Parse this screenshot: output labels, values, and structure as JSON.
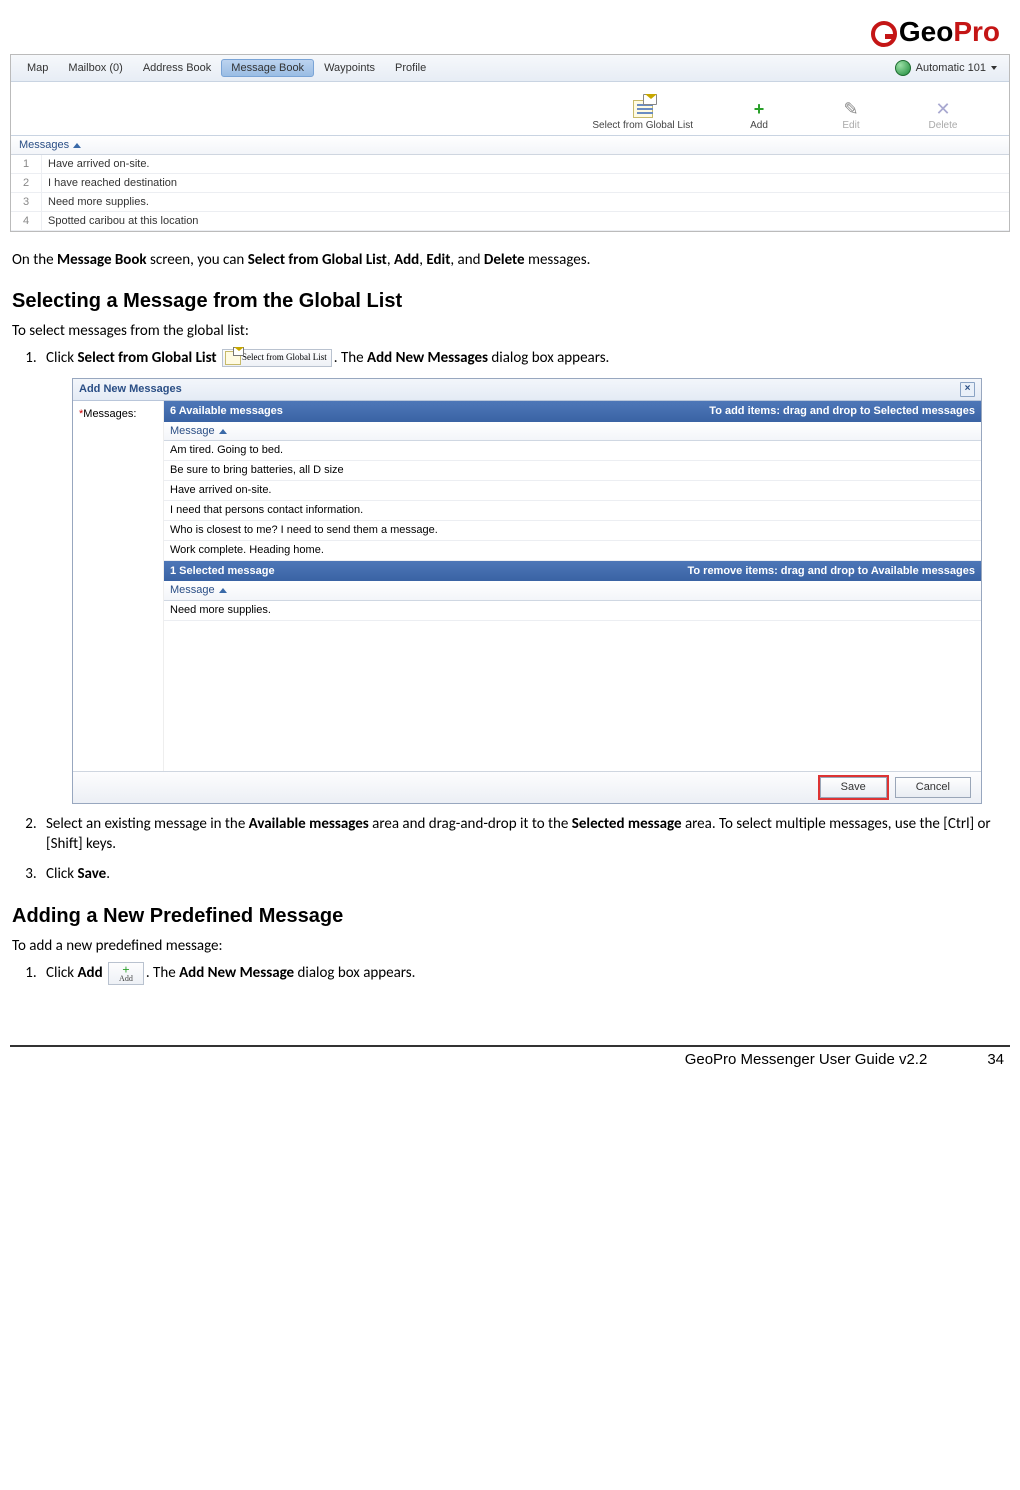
{
  "logo": {
    "part1": "Geo",
    "part2": "Pro"
  },
  "app": {
    "menu": [
      "Map",
      "Mailbox (0)",
      "Address Book",
      "Message Book",
      "Waypoints",
      "Profile"
    ],
    "menu_active_index": 3,
    "mode_label": "Automatic 101",
    "toolbar": {
      "select": "Select from Global List",
      "add": "Add",
      "edit": "Edit",
      "delete": "Delete"
    },
    "column_header": "Messages",
    "rows": [
      "Have arrived on-site.",
      "I have reached destination",
      "Need more supplies.",
      "Spotted caribou at this location"
    ]
  },
  "intro": {
    "pre": "On the ",
    "b1": "Message Book",
    "mid1": " screen, you can ",
    "b2": "Select from Global List",
    "c1": ", ",
    "b3": "Add",
    "c2": ", ",
    "b4": "Edit",
    "c3": ", and ",
    "b5": "Delete",
    "post": " messages."
  },
  "sectionA": {
    "heading": "Selecting a Message from the Global List",
    "lead": "To select messages from the global list:",
    "step1_a": "Click ",
    "step1_b": "Select from Global List",
    "step1_btn": "Select from Global List",
    "step1_c": ". The ",
    "step1_d": "Add New Messages",
    "step1_e": " dialog box appears.",
    "step2_a": "Select an existing message in the ",
    "step2_b": "Available messages",
    "step2_c": " area and drag-and-drop it to the ",
    "step2_d": "Selected message",
    "step2_e": " area. To select multiple messages, use the [Ctrl] or [Shift] keys.",
    "step3_a": "Click ",
    "step3_b": "Save",
    "step3_c": "."
  },
  "dialog": {
    "title": "Add New Messages",
    "field_label": "Messages:",
    "available_count": "6 Available messages",
    "available_hint": "To add items: drag and drop to Selected messages",
    "selected_count": "1 Selected message",
    "selected_hint": "To remove items: drag and drop to Available messages",
    "col_header": "Message",
    "available_rows": [
      "Am tired. Going to bed.",
      "Be sure to bring batteries, all D size",
      "Have arrived on-site.",
      "I need that persons contact information.",
      "Who is closest to me? I need to send them a message.",
      "Work complete. Heading home."
    ],
    "selected_rows": [
      "Need more supplies."
    ],
    "save": "Save",
    "cancel": "Cancel"
  },
  "sectionB": {
    "heading": "Adding a New Predefined Message",
    "lead": "To add a new predefined message:",
    "step1_a": "Click ",
    "step1_b": "Add",
    "step1_btn": "Add",
    "step1_c": ". The ",
    "step1_d": "Add New Message",
    "step1_e": " dialog box appears."
  },
  "footer": {
    "title": "GeoPro Messenger User Guide v2.2",
    "page": "34"
  }
}
